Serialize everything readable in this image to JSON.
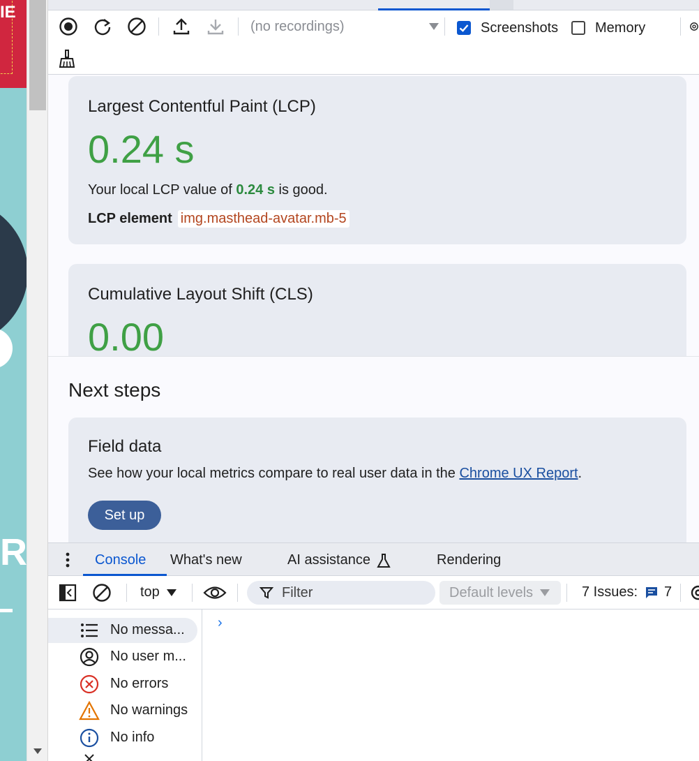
{
  "page": {
    "banner_text": "IE",
    "big_letter": "R"
  },
  "toolbar": {
    "recordings_placeholder": "(no recordings)",
    "screenshots_label": "Screenshots",
    "screenshots_checked": true,
    "memory_label": "Memory",
    "memory_checked": false
  },
  "lcp": {
    "title": "Largest Contentful Paint (LCP)",
    "value": "0.24 s",
    "desc_prefix": "Your local LCP value of ",
    "desc_value": "0.24 s",
    "desc_suffix": " is good.",
    "element_label": "LCP element",
    "element_value": "img.masthead-avatar.mb-5",
    "color": "#3fa045"
  },
  "cls": {
    "title": "Cumulative Layout Shift (CLS)",
    "value": "0.00"
  },
  "next_steps": {
    "heading": "Next steps",
    "field_title": "Field data",
    "field_desc_prefix": "See how your local metrics compare to real user data in the ",
    "field_link": "Chrome UX Report",
    "field_desc_suffix": ".",
    "setup_label": "Set up"
  },
  "drawer": {
    "tabs": [
      {
        "label": "Console",
        "active": true
      },
      {
        "label": "What's new"
      },
      {
        "label": "AI assistance"
      },
      {
        "label": "Rendering"
      }
    ]
  },
  "console": {
    "context": "top",
    "filter_placeholder": "Filter",
    "levels": "Default levels",
    "issues_label": "7 Issues:",
    "issues_count": "7",
    "sidebar": [
      {
        "label": "No messa...",
        "icon": "list-icon",
        "selected": true
      },
      {
        "label": "No user m...",
        "icon": "user-circle-icon"
      },
      {
        "label": "No errors",
        "icon": "error-circle-icon"
      },
      {
        "label": "No warnings",
        "icon": "warning-triangle-icon"
      },
      {
        "label": "No info",
        "icon": "info-circle-icon"
      }
    ],
    "prompt_symbol": "›"
  }
}
